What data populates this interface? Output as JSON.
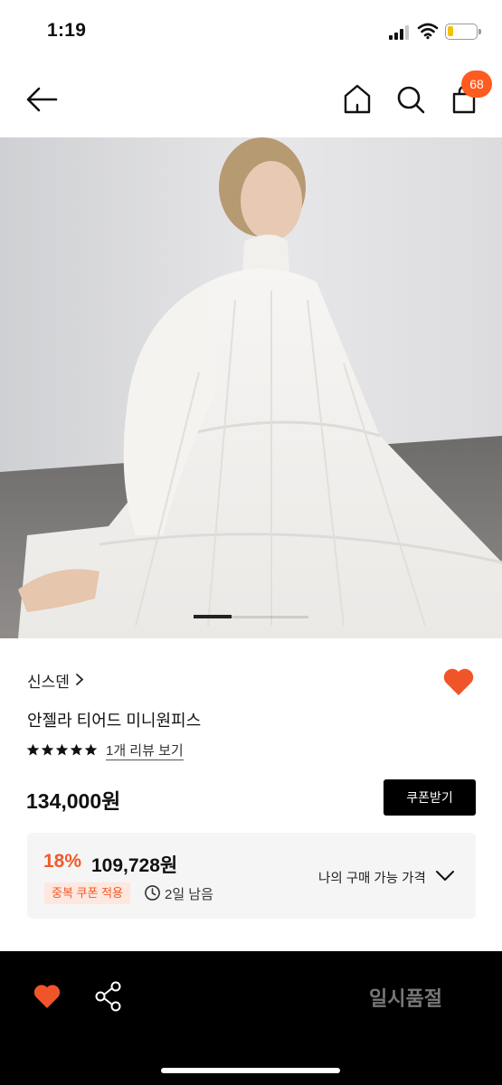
{
  "status_bar": {
    "time": "1:19"
  },
  "nav": {
    "cart_count": "68",
    "icons": [
      "back-arrow-icon",
      "home-icon",
      "search-icon",
      "shopping-bag-icon"
    ]
  },
  "product": {
    "image_pager": {
      "active_index": 1,
      "total": 3
    },
    "brand": "신스덴",
    "name": "안젤라 티어드 미니원피스",
    "rating_stars": 5,
    "review_link": "1개 리뷰 보기",
    "price": "134,000원",
    "coupon_button": "쿠폰받기",
    "wishlisted": true
  },
  "benefit": {
    "discount_rate": "18%",
    "discount_price": "109,728원",
    "coupon_tag": "중복 쿠폰 적용",
    "remaining": "2일 남음",
    "my_price_label": "나의 구매 가능 가격"
  },
  "bottom_bar": {
    "sold_out_label": "일시품절"
  },
  "colors": {
    "accent": "#f05a28",
    "heart": "#f0552a",
    "badge": "#ff5a1f",
    "bar": "#000000"
  }
}
